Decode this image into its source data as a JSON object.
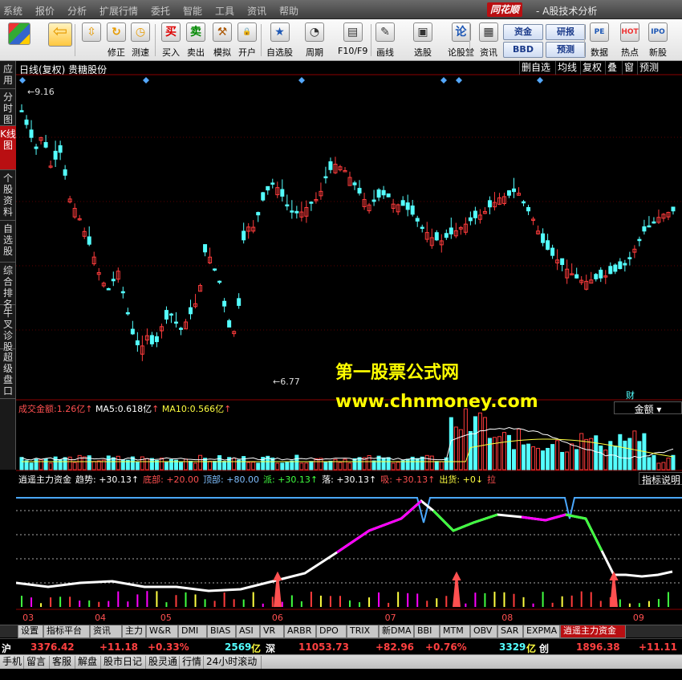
{
  "menu": [
    "系统",
    "报价",
    "分析",
    "扩展行情",
    "委托",
    "智能",
    "工具",
    "资讯",
    "帮助"
  ],
  "app": {
    "logo": "同花顺",
    "title": "- A股技术分析"
  },
  "toolbar": {
    "buttons": [
      {
        "label": "修正",
        "icon": "refresh-icon"
      },
      {
        "label": "测速",
        "icon": "clock-icon"
      },
      {
        "label": "买入",
        "icon": "buy-icon"
      },
      {
        "label": "卖出",
        "icon": "sell-icon"
      },
      {
        "label": "模拟",
        "icon": "hammer-icon"
      },
      {
        "label": "开户",
        "icon": "lock-icon"
      },
      {
        "label": "自选股",
        "icon": "star-icon"
      },
      {
        "label": "周期",
        "icon": "period-icon"
      },
      {
        "label": "F10/F9",
        "icon": "f10-icon"
      },
      {
        "label": "画线",
        "icon": "pencil-icon"
      },
      {
        "label": "选股",
        "icon": "screen-icon"
      },
      {
        "label": "论股堂",
        "icon": "forum-icon"
      },
      {
        "label": "资讯",
        "icon": "news-icon"
      },
      {
        "label": "数据",
        "icon": "pe-icon"
      },
      {
        "label": "热点",
        "icon": "hot-icon"
      },
      {
        "label": "新股",
        "icon": "ipo-icon"
      }
    ],
    "boxes": [
      "资金",
      "研报",
      "BBD",
      "预测"
    ],
    "icon_glyphs": {
      "pe": "PE",
      "hot": "HOT",
      "ipo": "IPO",
      "forum": "论"
    }
  },
  "sidebar": [
    "应用",
    "分时图",
    "K线图",
    "个股资料",
    "自选股",
    "综合排名",
    "牛叉诊股",
    "超级盘口"
  ],
  "chart": {
    "title": "日线(复权) 贵糖股份",
    "right_buttons": [
      "删自选",
      "均线",
      "复权",
      "叠",
      "窗",
      "预测"
    ],
    "high_label": "9.16",
    "low_label": "6.77",
    "cai_label": "财",
    "volume_header": {
      "name": "成交金额:",
      "value": "1.26亿",
      "ma5_name": "MA5:",
      "ma5": "0.618亿",
      "ma10_name": "MA10:",
      "ma10": "0.566亿",
      "dropdown": "金额"
    },
    "indicator_header": [
      {
        "text": "逍遥主力资金",
        "color": "#ffffff"
      },
      {
        "text": "趋势: +30.13↑",
        "color": "#ffffff"
      },
      {
        "text": "底部: +20.00",
        "color": "#ff5050"
      },
      {
        "text": "顶部: +80.00",
        "color": "#7fbfff"
      },
      {
        "text": "派: +30.13↑",
        "color": "#40ff40"
      },
      {
        "text": "落: +30.13↑",
        "color": "#ffffff"
      },
      {
        "text": "吸: +30.13↑",
        "color": "#ff5050"
      },
      {
        "text": "出货: +0↓",
        "color": "#ffff40"
      },
      {
        "text": "拉",
        "color": "#ff5050"
      }
    ],
    "indicator_btn": "指标说明",
    "x_labels": [
      {
        "text": "03",
        "frac": 0.005
      },
      {
        "text": "04",
        "frac": 0.115
      },
      {
        "text": "05",
        "frac": 0.215
      },
      {
        "text": "06",
        "frac": 0.385
      },
      {
        "text": "07",
        "frac": 0.557
      },
      {
        "text": "08",
        "frac": 0.735
      },
      {
        "text": "09",
        "frac": 0.935
      }
    ],
    "watermark_title": "第一股票公式网",
    "watermark_url": "www.chnmoney.com"
  },
  "tabs": [
    "设置",
    "指标平台",
    "资讯",
    "主力",
    "W&R",
    "DMI",
    "BIAS",
    "ASI",
    "VR",
    "ARBR",
    "DPO",
    "TRIX",
    "新DMA",
    "BBI",
    "MTM",
    "OBV",
    "SAR",
    "EXPMA",
    "逍遥主力资金"
  ],
  "active_tab": "逍遥主力资金",
  "indexbar": {
    "sh_label": "沪",
    "sh_value": "3376.42",
    "sh_change": "+11.18",
    "sh_pct": "+0.33%",
    "sh_amount": "2569",
    "sh_unit": "亿",
    "sz_label": "深",
    "sz_value": "11053.73",
    "sz_change": "+82.96",
    "sz_pct": "+0.76%",
    "sz_amount": "3329",
    "sz_unit": "亿",
    "cy_label": "创",
    "cy_value": "1896.38",
    "cy_change": "+11.11"
  },
  "status": [
    "手机",
    "留言",
    "客服",
    "解盘",
    "股市日记",
    "股灵通",
    "行情",
    "24小时滚动"
  ],
  "colors": {
    "up": "#ff3c3c",
    "down": "#54ffff",
    "accent": "#b90f12",
    "yellow": "#ffff00",
    "magenta": "#ff00ff"
  }
}
